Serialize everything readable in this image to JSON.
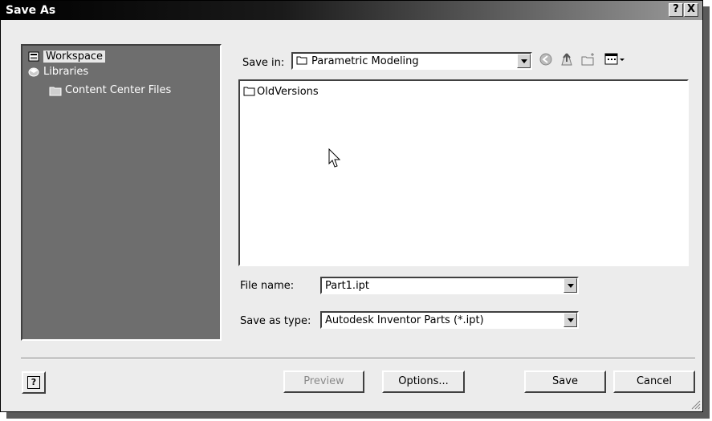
{
  "window": {
    "title": "Save As",
    "help_btn": "?",
    "close_btn": "X"
  },
  "sidebar": {
    "items": [
      {
        "label": "Workspace",
        "icon": "workspace-icon"
      },
      {
        "label": "Libraries",
        "icon": "libraries-icon"
      },
      {
        "label": "Content Center Files",
        "icon": "folder-icon"
      }
    ]
  },
  "save_in": {
    "label": "Save in:",
    "value": "Parametric Modeling"
  },
  "file_list": {
    "items": [
      {
        "name": "OldVersions",
        "icon": "folder-icon"
      }
    ]
  },
  "file_name": {
    "label": "File name:",
    "value": "Part1.ipt"
  },
  "save_type": {
    "label": "Save as type:",
    "value": "Autodesk Inventor Parts (*.ipt)"
  },
  "buttons": {
    "help": "?",
    "preview": "Preview",
    "options": "Options...",
    "save": "Save",
    "cancel": "Cancel"
  }
}
